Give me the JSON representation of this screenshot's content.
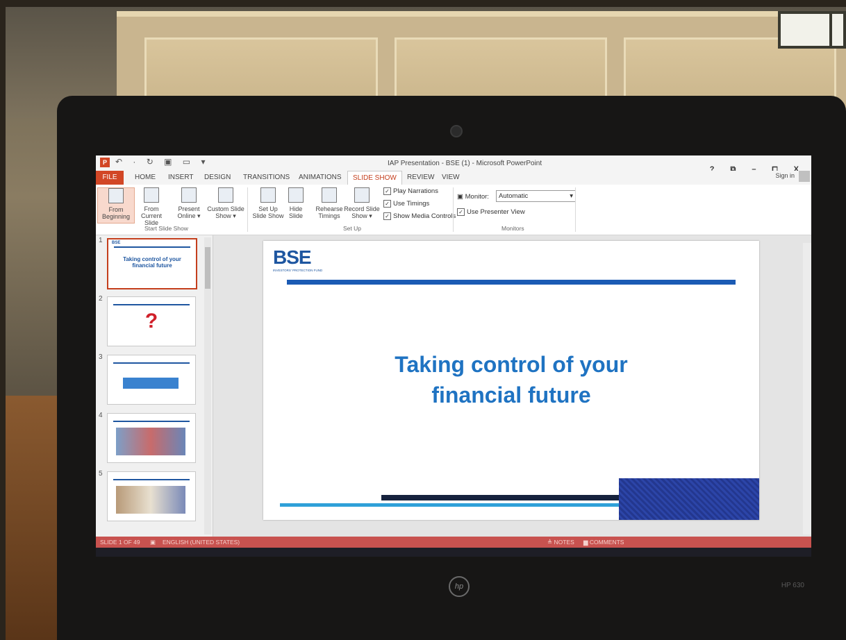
{
  "window": {
    "title": "IAP Presentation - BSE (1) - Microsoft PowerPoint",
    "controls": "? ⧉ – ⧠ X",
    "sign_in": "Sign in"
  },
  "quick_access": "↶ ·  ↻ ▣ ▭ ▾",
  "tabs": [
    "FILE",
    "HOME",
    "INSERT",
    "DESIGN",
    "TRANSITIONS",
    "ANIMATIONS",
    "SLIDE SHOW",
    "REVIEW",
    "VIEW"
  ],
  "ribbon": {
    "from_beginning": "From\nBeginning",
    "from_current": "From\nCurrent Slide",
    "present_online": "Present\nOnline ▾",
    "custom_show": "Custom Slide\nShow ▾",
    "set_up": "Set Up\nSlide Show",
    "hide_slide": "Hide\nSlide",
    "rehearse": "Rehearse\nTimings",
    "record": "Record Slide\nShow ▾",
    "play_narrations": "Play Narrations",
    "use_timings": "Use Timings",
    "show_media_controls": "Show Media Controls",
    "monitor_label": "Monitor:",
    "monitor_value": "Automatic",
    "use_presenter_view": "Use Presenter View",
    "group_start": "Start Slide Show",
    "group_setup": "Set Up",
    "group_monitors": "Monitors"
  },
  "thumbnails": [
    {
      "num": "1",
      "text": "Taking control of your financial future"
    },
    {
      "num": "2",
      "text": "?"
    },
    {
      "num": "3",
      "text": ""
    },
    {
      "num": "4",
      "text": ""
    },
    {
      "num": "5",
      "text": ""
    }
  ],
  "slide": {
    "logo": "BSE",
    "logo_sub": "INVESTORS' PROTECTION FUND",
    "title_line1": "Taking control of your",
    "title_line2": "financial future"
  },
  "status": {
    "slide_count": "SLIDE 1 OF 49",
    "language": "ENGLISH (UNITED STATES)",
    "notes": "≜ NOTES",
    "comments": "▆ COMMENTS"
  },
  "laptop": {
    "brand": "hp",
    "model": "HP 630"
  }
}
